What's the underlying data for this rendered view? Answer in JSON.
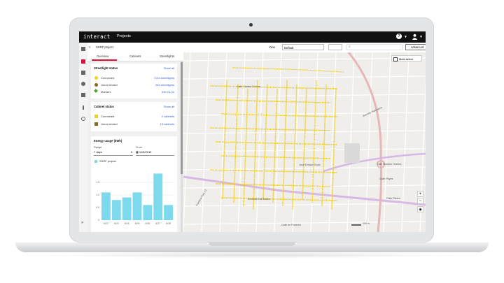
{
  "app": {
    "logo": "interact",
    "projects_label": "Projects"
  },
  "toolbar": {
    "project_name": "SSRF project",
    "view_label": "View",
    "view_value": "Default",
    "advanced_label": "Advanced"
  },
  "tabs": [
    {
      "label": "Overview"
    },
    {
      "label": "Cabinets"
    },
    {
      "label": "Streetlights"
    }
  ],
  "streetlight_status": {
    "title": "Streetlight status",
    "show_all": "Show all",
    "rows": [
      {
        "label": "Connected",
        "value": "7133 streetlights",
        "color": "#f5d312"
      },
      {
        "label": "Unconnected",
        "value": "233 streetlights",
        "color": "#8a6a1d"
      },
      {
        "label": "Markers",
        "value": "330 OLCs",
        "color": "#49a12a"
      }
    ]
  },
  "cabinet_status": {
    "title": "Cabinet status",
    "show_all": "Show all",
    "rows": [
      {
        "label": "Connected",
        "value": "2 cabinets",
        "color": "#f5d312"
      },
      {
        "label": "Unconnected",
        "value": "15 cabinets",
        "color": "#8a6a1d"
      }
    ]
  },
  "energy": {
    "title": "Energy usage (kWh)",
    "range_label": "Range",
    "range_value": "7 days",
    "from_label": "From",
    "from_value": "11/5/2019",
    "legend": "SSRF project",
    "bar_color": "#7dd9ec"
  },
  "chart_data": {
    "type": "bar",
    "categories": [
      "6/22",
      "6/23",
      "6/24",
      "6/25",
      "6/26",
      "6/27",
      "6/28"
    ],
    "values": [
      1.1,
      0.8,
      0.9,
      1.1,
      0.6,
      1.85,
      0.6
    ],
    "yticks": [
      "0",
      "0.5",
      "1.0",
      "1.5"
    ],
    "ylim": [
      0,
      2
    ],
    "series": [
      {
        "name": "SSRF project",
        "values": [
          1.1,
          0.8,
          0.9,
          1.1,
          0.6,
          1.85,
          0.6
        ]
      }
    ]
  },
  "map": {
    "multiselect_label": "Multi-select",
    "zoom_in": "+",
    "zoom_out": "−",
    "road_labels": [
      {
        "text": "Calle Mariano Herrera"
      },
      {
        "text": "Calle Reyes"
      },
      {
        "text": "José Enrique Rodó"
      },
      {
        "text": "Calle Ciudad Colonia"
      },
      {
        "text": "Avenida Salvadora"
      },
      {
        "text": "Avenida Gral Martín"
      },
      {
        "text": "Frontera Ruta 12"
      },
      {
        "text": "Calle de Pucarea"
      },
      {
        "text": "Calle Piedra"
      }
    ],
    "scale": "200 m"
  }
}
